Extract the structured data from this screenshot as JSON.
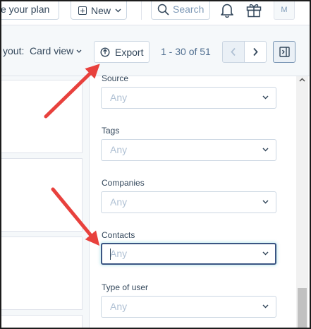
{
  "topbar": {
    "upgrade_label": "e your plan",
    "new_label": "New",
    "search_placeholder": "Search",
    "avatar_initial": "M"
  },
  "toolbar": {
    "layout_label": "yout:",
    "layout_value": "Card view",
    "export_label": "Export",
    "pagination_text": "1 - 30 of 51"
  },
  "filters": [
    {
      "label": "Source",
      "value": "Any"
    },
    {
      "label": "Tags",
      "value": "Any"
    },
    {
      "label": "Companies",
      "value": "Any"
    },
    {
      "label": "Contacts",
      "value": "Any",
      "focused": true
    },
    {
      "label": "Type of user",
      "value": "Any"
    }
  ],
  "colors": {
    "annotation_arrow": "#e8413d",
    "focus_border": "#3b5583",
    "text": "#33475b",
    "placeholder": "#b0c1d4"
  }
}
